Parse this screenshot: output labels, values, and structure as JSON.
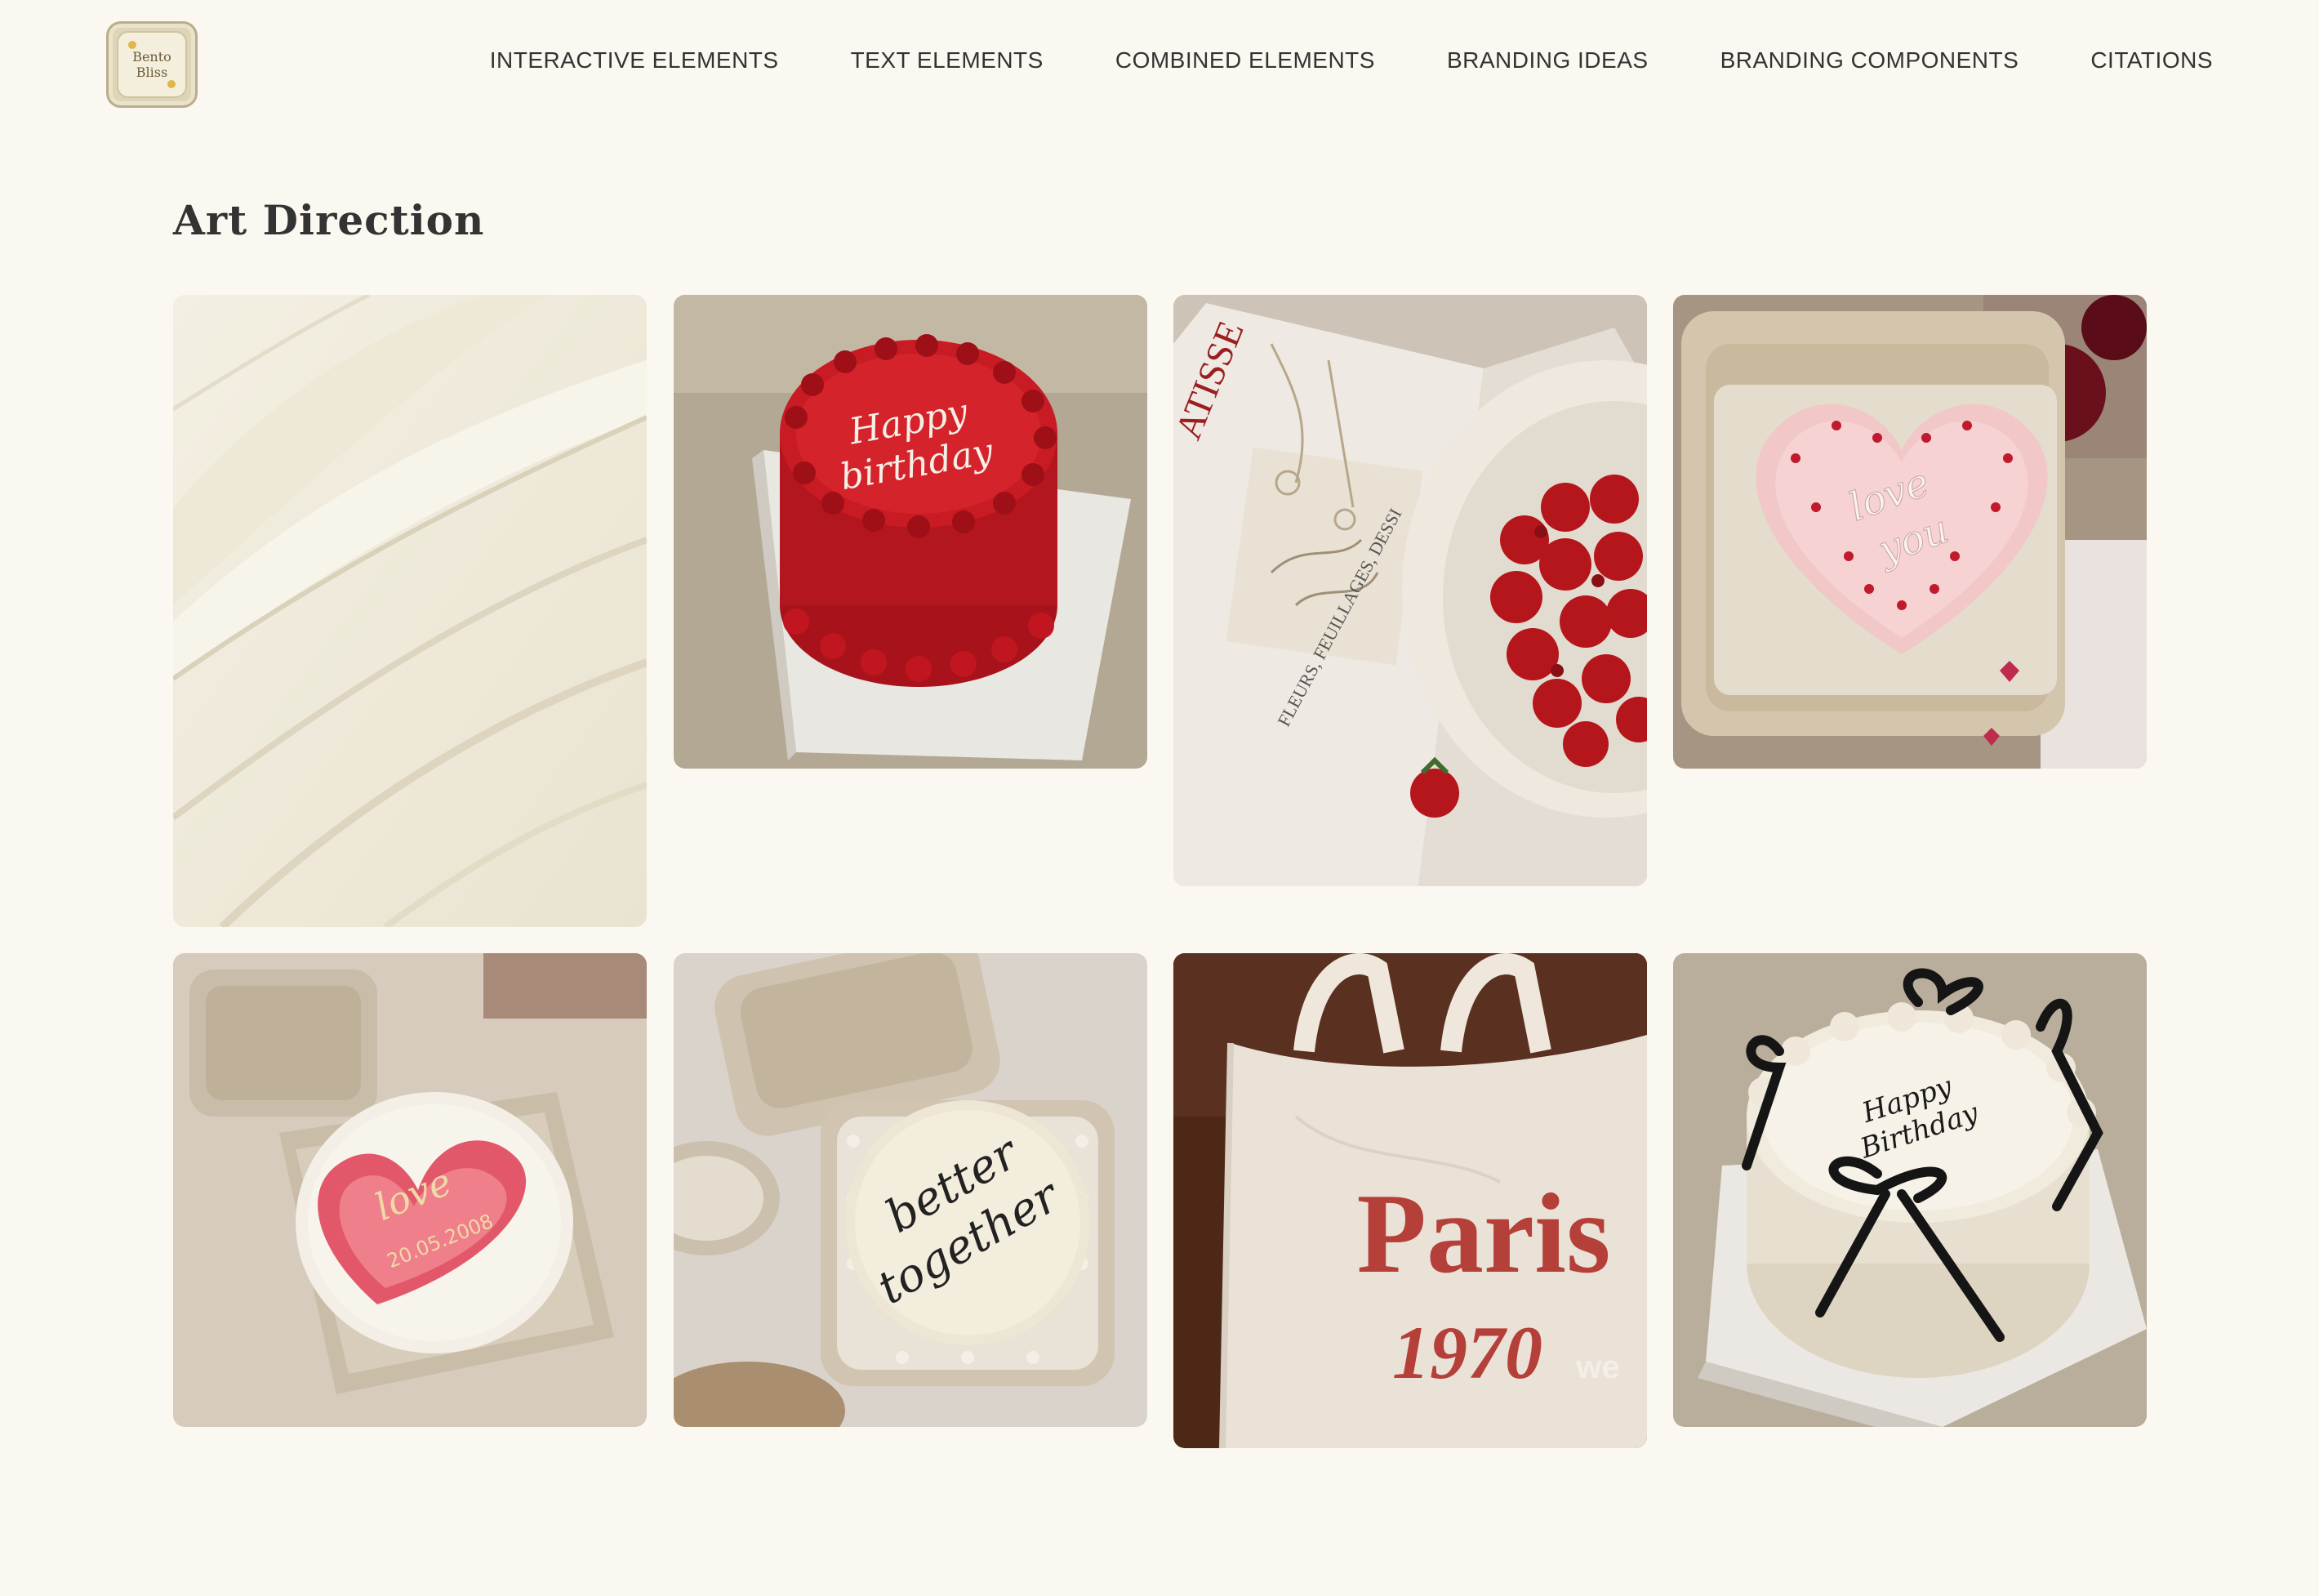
{
  "logo": {
    "line1": "Bento",
    "line2": "Bliss"
  },
  "nav": {
    "items": [
      "INTERACTIVE ELEMENTS",
      "TEXT ELEMENTS",
      "COMBINED ELEMENTS",
      "BRANDING IDEAS",
      "BRANDING COMPONENTS",
      "CITATIONS"
    ]
  },
  "page": {
    "title": "Art Direction"
  },
  "gallery": {
    "cake_red_text_1": "Happy",
    "cake_red_text_2": "birthday",
    "book_text_1": "ATISSE",
    "book_text_2": "FLEURS, FEUILLAGES, DESSI",
    "heart_text_1": "love",
    "heart_text_2": "you",
    "pink_heart_text_1": "love",
    "pink_heart_text_2": "20.05.2008",
    "white_cake_text_1": "better",
    "white_cake_text_2": "together",
    "tote_text_1": "Paris",
    "tote_text_2": "1970",
    "tote_text_3": "we",
    "bow_cake_text_1": "Happy",
    "bow_cake_text_2": "Birthday"
  },
  "colors": {
    "background": "#fbf8f1",
    "text": "#2b2b2b",
    "red_cake": "#c0161f",
    "tote_red": "#b5403a"
  }
}
